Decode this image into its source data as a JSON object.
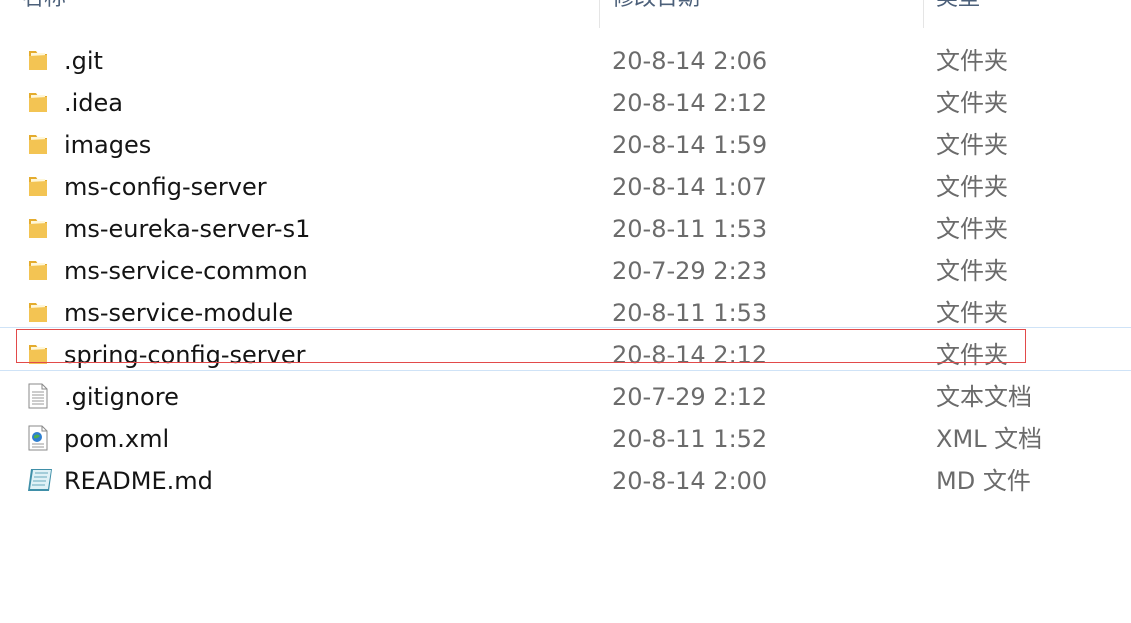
{
  "columns": {
    "name": "名称",
    "date": "修改日期",
    "type": "类型"
  },
  "files": [
    {
      "name": ".git",
      "date": "20-8-14 2:06",
      "type": "文件夹",
      "icon": "folder-icon"
    },
    {
      "name": ".idea",
      "date": "20-8-14 2:12",
      "type": "文件夹",
      "icon": "folder-icon"
    },
    {
      "name": "images",
      "date": "20-8-14 1:59",
      "type": "文件夹",
      "icon": "folder-icon"
    },
    {
      "name": "ms-config-server",
      "date": "20-8-14 1:07",
      "type": "文件夹",
      "icon": "folder-icon"
    },
    {
      "name": "ms-eureka-server-s1",
      "date": "20-8-11 1:53",
      "type": "文件夹",
      "icon": "folder-icon"
    },
    {
      "name": "ms-service-common",
      "date": "20-7-29 2:23",
      "type": "文件夹",
      "icon": "folder-icon"
    },
    {
      "name": "ms-service-module",
      "date": "20-8-11 1:53",
      "type": "文件夹",
      "icon": "folder-icon"
    },
    {
      "name": "spring-config-server",
      "date": "20-8-14 2:12",
      "type": "文件夹",
      "icon": "folder-icon"
    },
    {
      "name": ".gitignore",
      "date": "20-7-29 2:12",
      "type": "文本文档",
      "icon": "text-file-icon"
    },
    {
      "name": "pom.xml",
      "date": "20-8-11 1:52",
      "type": "XML 文档",
      "icon": "xml-file-icon"
    },
    {
      "name": "README.md",
      "date": "20-8-14 2:00",
      "type": "MD 文件",
      "icon": "markdown-file-icon"
    }
  ],
  "colors": {
    "folder": "#f3c453",
    "selection_border": "#e24a4a",
    "hover_line": "#cfe3f7"
  }
}
